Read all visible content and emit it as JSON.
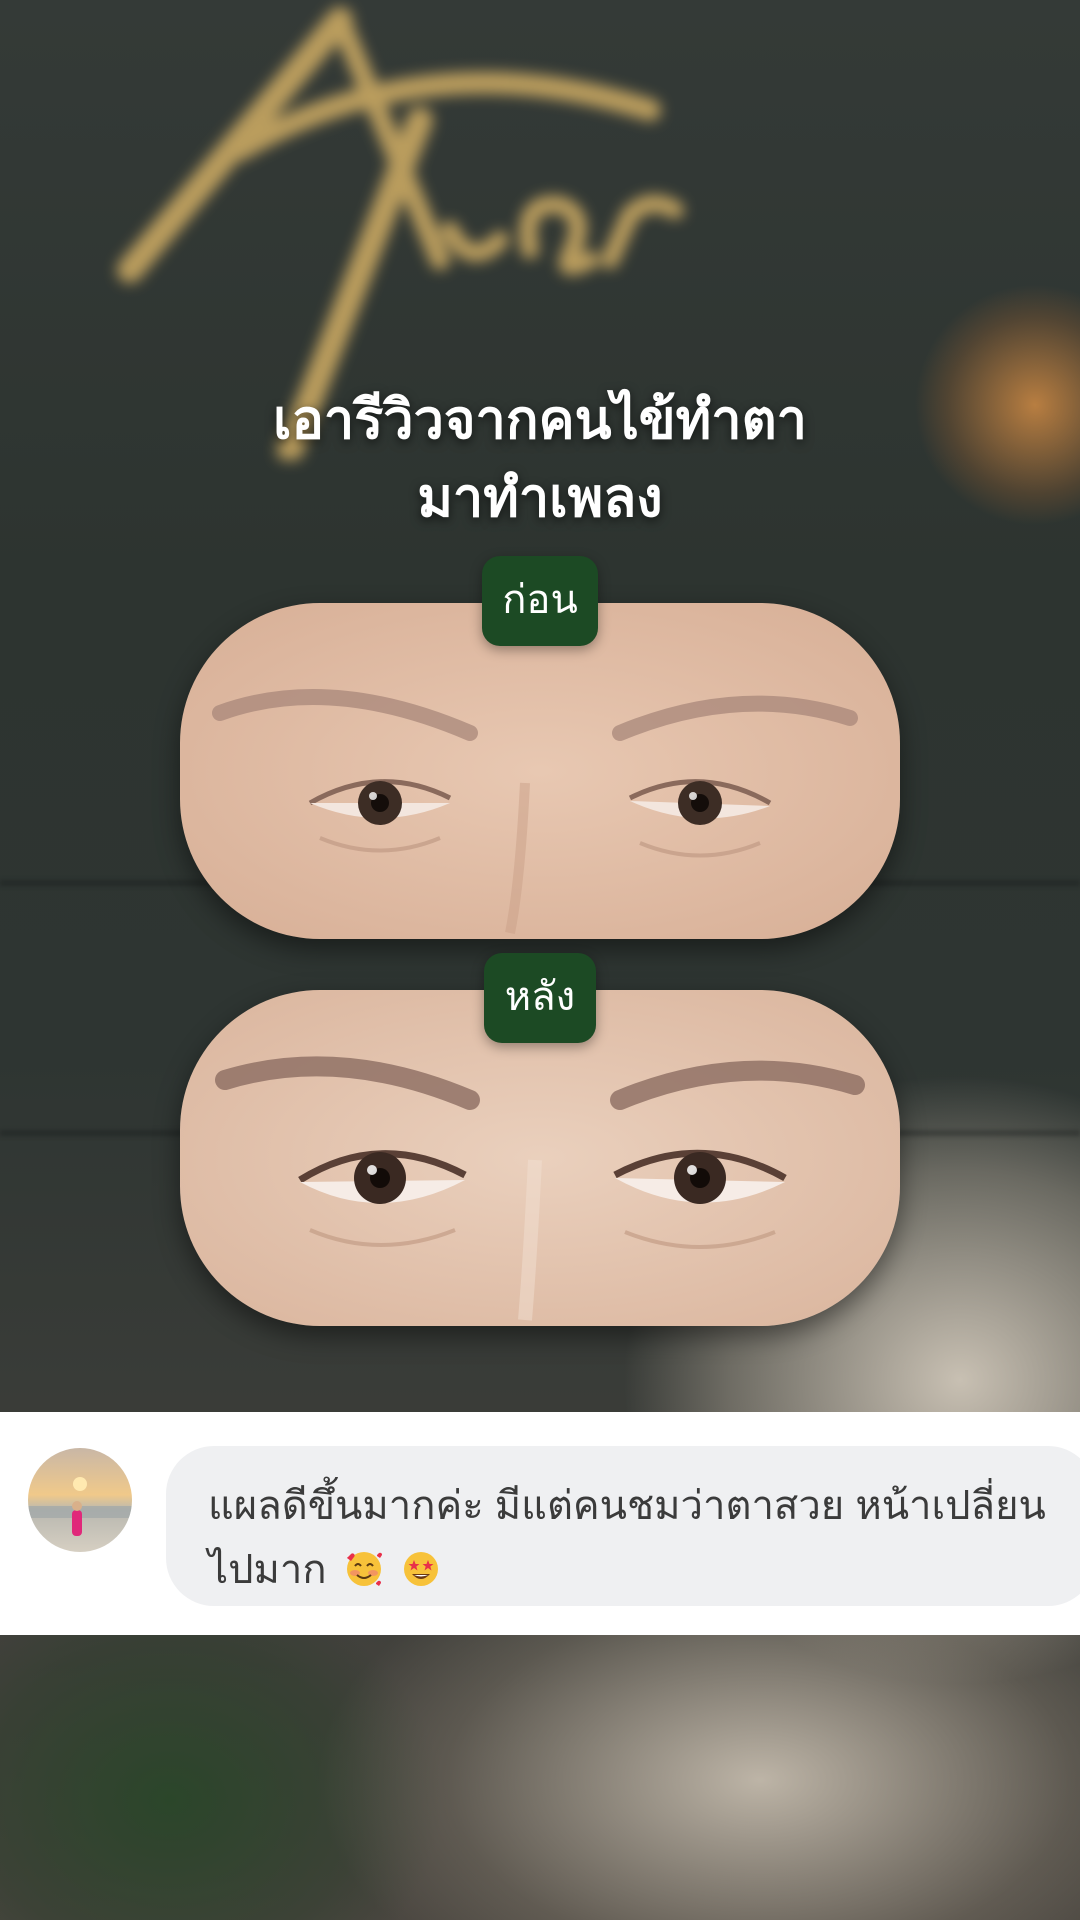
{
  "headline": {
    "line1": "เอารีวิวจากคนไข้ทำตา",
    "line2": "มาทำเพลง"
  },
  "before": {
    "label": "ก่อน"
  },
  "after": {
    "label": "หลัง"
  },
  "comment": {
    "text": "แผลดีขึ้นมากค่ะ มีแต่คนชมว่าตาสวย หน้าเปลี่ยนไปมาก",
    "emojis": [
      "smiling-face-with-hearts-icon",
      "star-struck-icon"
    ]
  },
  "colors": {
    "tag_green": "#1c4a24",
    "bubble_gray": "#eff0f2",
    "gold": "#c9a862"
  }
}
